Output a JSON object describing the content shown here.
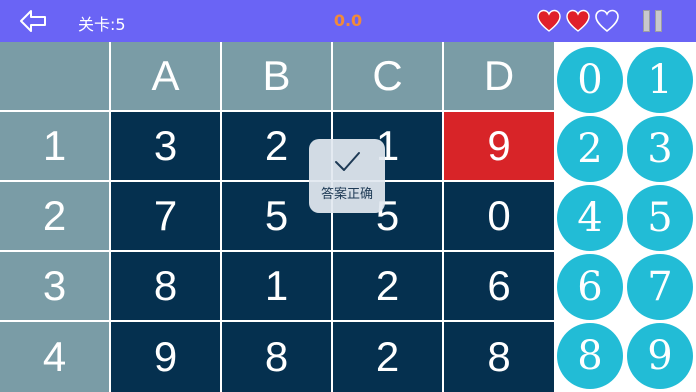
{
  "top_bar": {
    "level_label": "关卡:5",
    "score": "0.0",
    "lives_total": 3,
    "lives_remaining": 2,
    "colors": {
      "background": "#6a64f5",
      "score": "#f08a3a",
      "heart": "#e0202a"
    },
    "icons": [
      "back-arrow-icon",
      "heart-icon",
      "pause-icon"
    ]
  },
  "grid": {
    "columns": [
      "A",
      "B",
      "C",
      "D"
    ],
    "rows": [
      {
        "label": "1",
        "values": [
          "3",
          "2",
          "1",
          "9"
        ]
      },
      {
        "label": "2",
        "values": [
          "7",
          "5",
          "5",
          "0"
        ]
      },
      {
        "label": "3",
        "values": [
          "8",
          "1",
          "2",
          "6"
        ]
      },
      {
        "label": "4",
        "values": [
          "9",
          "8",
          "2",
          "8"
        ]
      }
    ],
    "highlighted_cell": "D1",
    "colors": {
      "header": "#7a9ca6",
      "cell": "#05304f",
      "highlight": "#d82428"
    }
  },
  "toast": {
    "text": "答案正确",
    "icon": "checkmark-icon"
  },
  "number_pad": {
    "keys": [
      "0",
      "1",
      "2",
      "3",
      "4",
      "5",
      "6",
      "7",
      "8",
      "9"
    ],
    "color": "#22bcd6"
  }
}
